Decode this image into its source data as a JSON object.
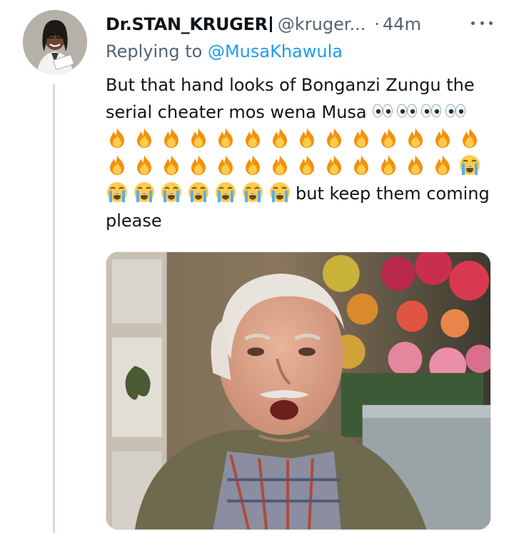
{
  "tweet": {
    "display_name": "Dr.STAN_KRUGER",
    "handle": "@kruger...",
    "separator": "·",
    "time": "44m",
    "replying_label": "Replying to",
    "replying_to": "@MusaKhawula",
    "line1": "But that hand looks of Bonganzi Zungu the",
    "line2": "serial cheater mos wena Musa",
    "line5_tail": "but keep them coming",
    "line6": "please",
    "emoji": {
      "eyes_count": 4,
      "fire_row1_count": 14,
      "fire_row2_count": 13,
      "cry_row2_count": 1,
      "cry_row3_count": 7
    }
  },
  "icons": {
    "more": "more-dots-icon",
    "eyes": "eyes-emoji-icon",
    "fire": "fire-emoji-icon",
    "cry": "loudly-crying-emoji-icon"
  },
  "colors": {
    "text": "#0f1419",
    "secondary": "#536471",
    "link": "#1d9bf0",
    "thread_line": "#cfd9de"
  }
}
